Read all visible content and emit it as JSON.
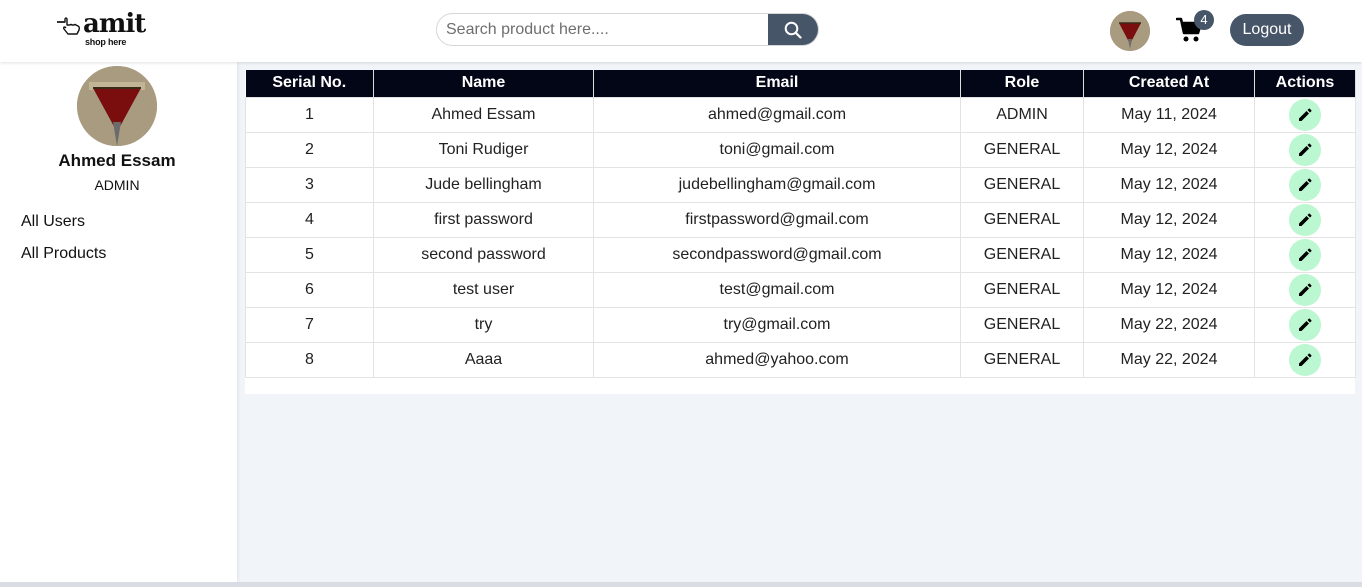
{
  "header": {
    "logo_word": "amit",
    "logo_tagline": "shop here",
    "search_placeholder": "Search product here....",
    "cart_count": "4",
    "logout_label": "Logout"
  },
  "sidebar": {
    "user_name": "Ahmed Essam",
    "user_role": "ADMIN",
    "links": [
      {
        "label": "All Users"
      },
      {
        "label": "All Products"
      }
    ]
  },
  "table": {
    "columns": [
      "Serial No.",
      "Name",
      "Email",
      "Role",
      "Created At",
      "Actions"
    ],
    "rows": [
      {
        "serial": "1",
        "name": "Ahmed Essam",
        "email": "ahmed@gmail.com",
        "role": "ADMIN",
        "created": "May 11, 2024"
      },
      {
        "serial": "2",
        "name": "Toni Rudiger",
        "email": "toni@gmail.com",
        "role": "GENERAL",
        "created": "May 12, 2024"
      },
      {
        "serial": "3",
        "name": "Jude bellingham",
        "email": "judebellingham@gmail.com",
        "role": "GENERAL",
        "created": "May 12, 2024"
      },
      {
        "serial": "4",
        "name": "first password",
        "email": "firstpassword@gmail.com",
        "role": "GENERAL",
        "created": "May 12, 2024"
      },
      {
        "serial": "5",
        "name": "second password",
        "email": "secondpassword@gmail.com",
        "role": "GENERAL",
        "created": "May 12, 2024"
      },
      {
        "serial": "6",
        "name": "test user",
        "email": "test@gmail.com",
        "role": "GENERAL",
        "created": "May 12, 2024"
      },
      {
        "serial": "7",
        "name": "try",
        "email": "try@gmail.com",
        "role": "GENERAL",
        "created": "May 22, 2024"
      },
      {
        "serial": "8",
        "name": "Aaaa",
        "email": "ahmed@yahoo.com",
        "role": "GENERAL",
        "created": "May 22, 2024"
      }
    ]
  },
  "icons": {
    "search": "search-icon",
    "cart": "cart-icon",
    "edit": "pencil-icon",
    "hand": "pointing-hand-icon"
  },
  "colors": {
    "header_dark": "#020617",
    "accent_slate": "#475569",
    "edit_green": "#bbf7d0",
    "page_bg": "#f1f4f8"
  }
}
